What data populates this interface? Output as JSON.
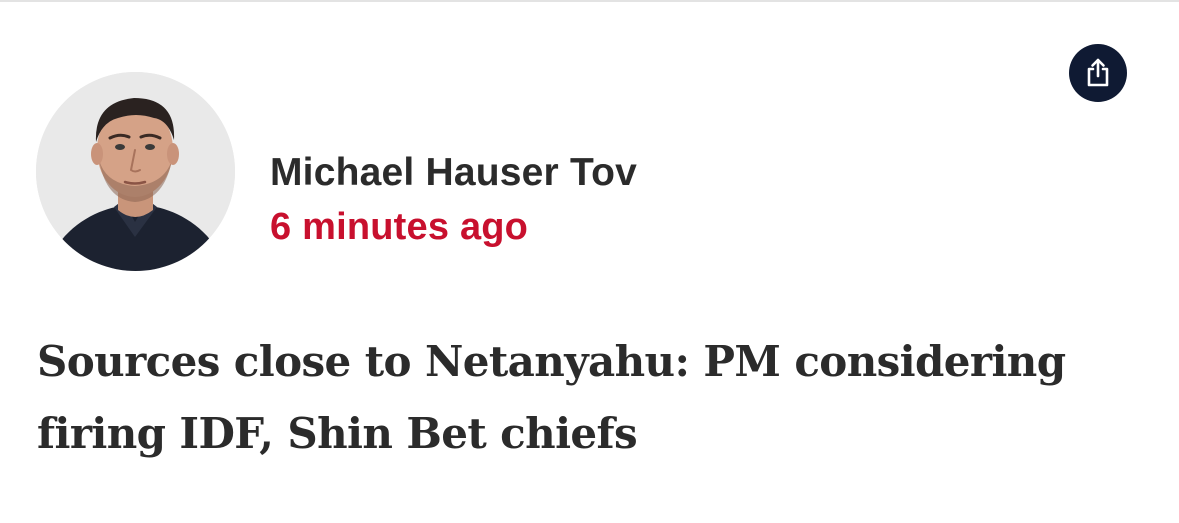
{
  "share": {
    "icon": "share-icon"
  },
  "author": {
    "name": "Michael Hauser Tov",
    "avatar_icon": "author-portrait"
  },
  "post": {
    "timestamp": "6 minutes ago",
    "headline": "Sources close to Netanyahu: PM considering firing IDF, Shin Bet chiefs"
  },
  "colors": {
    "share_bg": "#0f1a33",
    "timestamp": "#c8102e",
    "text": "#2b2b2b"
  }
}
